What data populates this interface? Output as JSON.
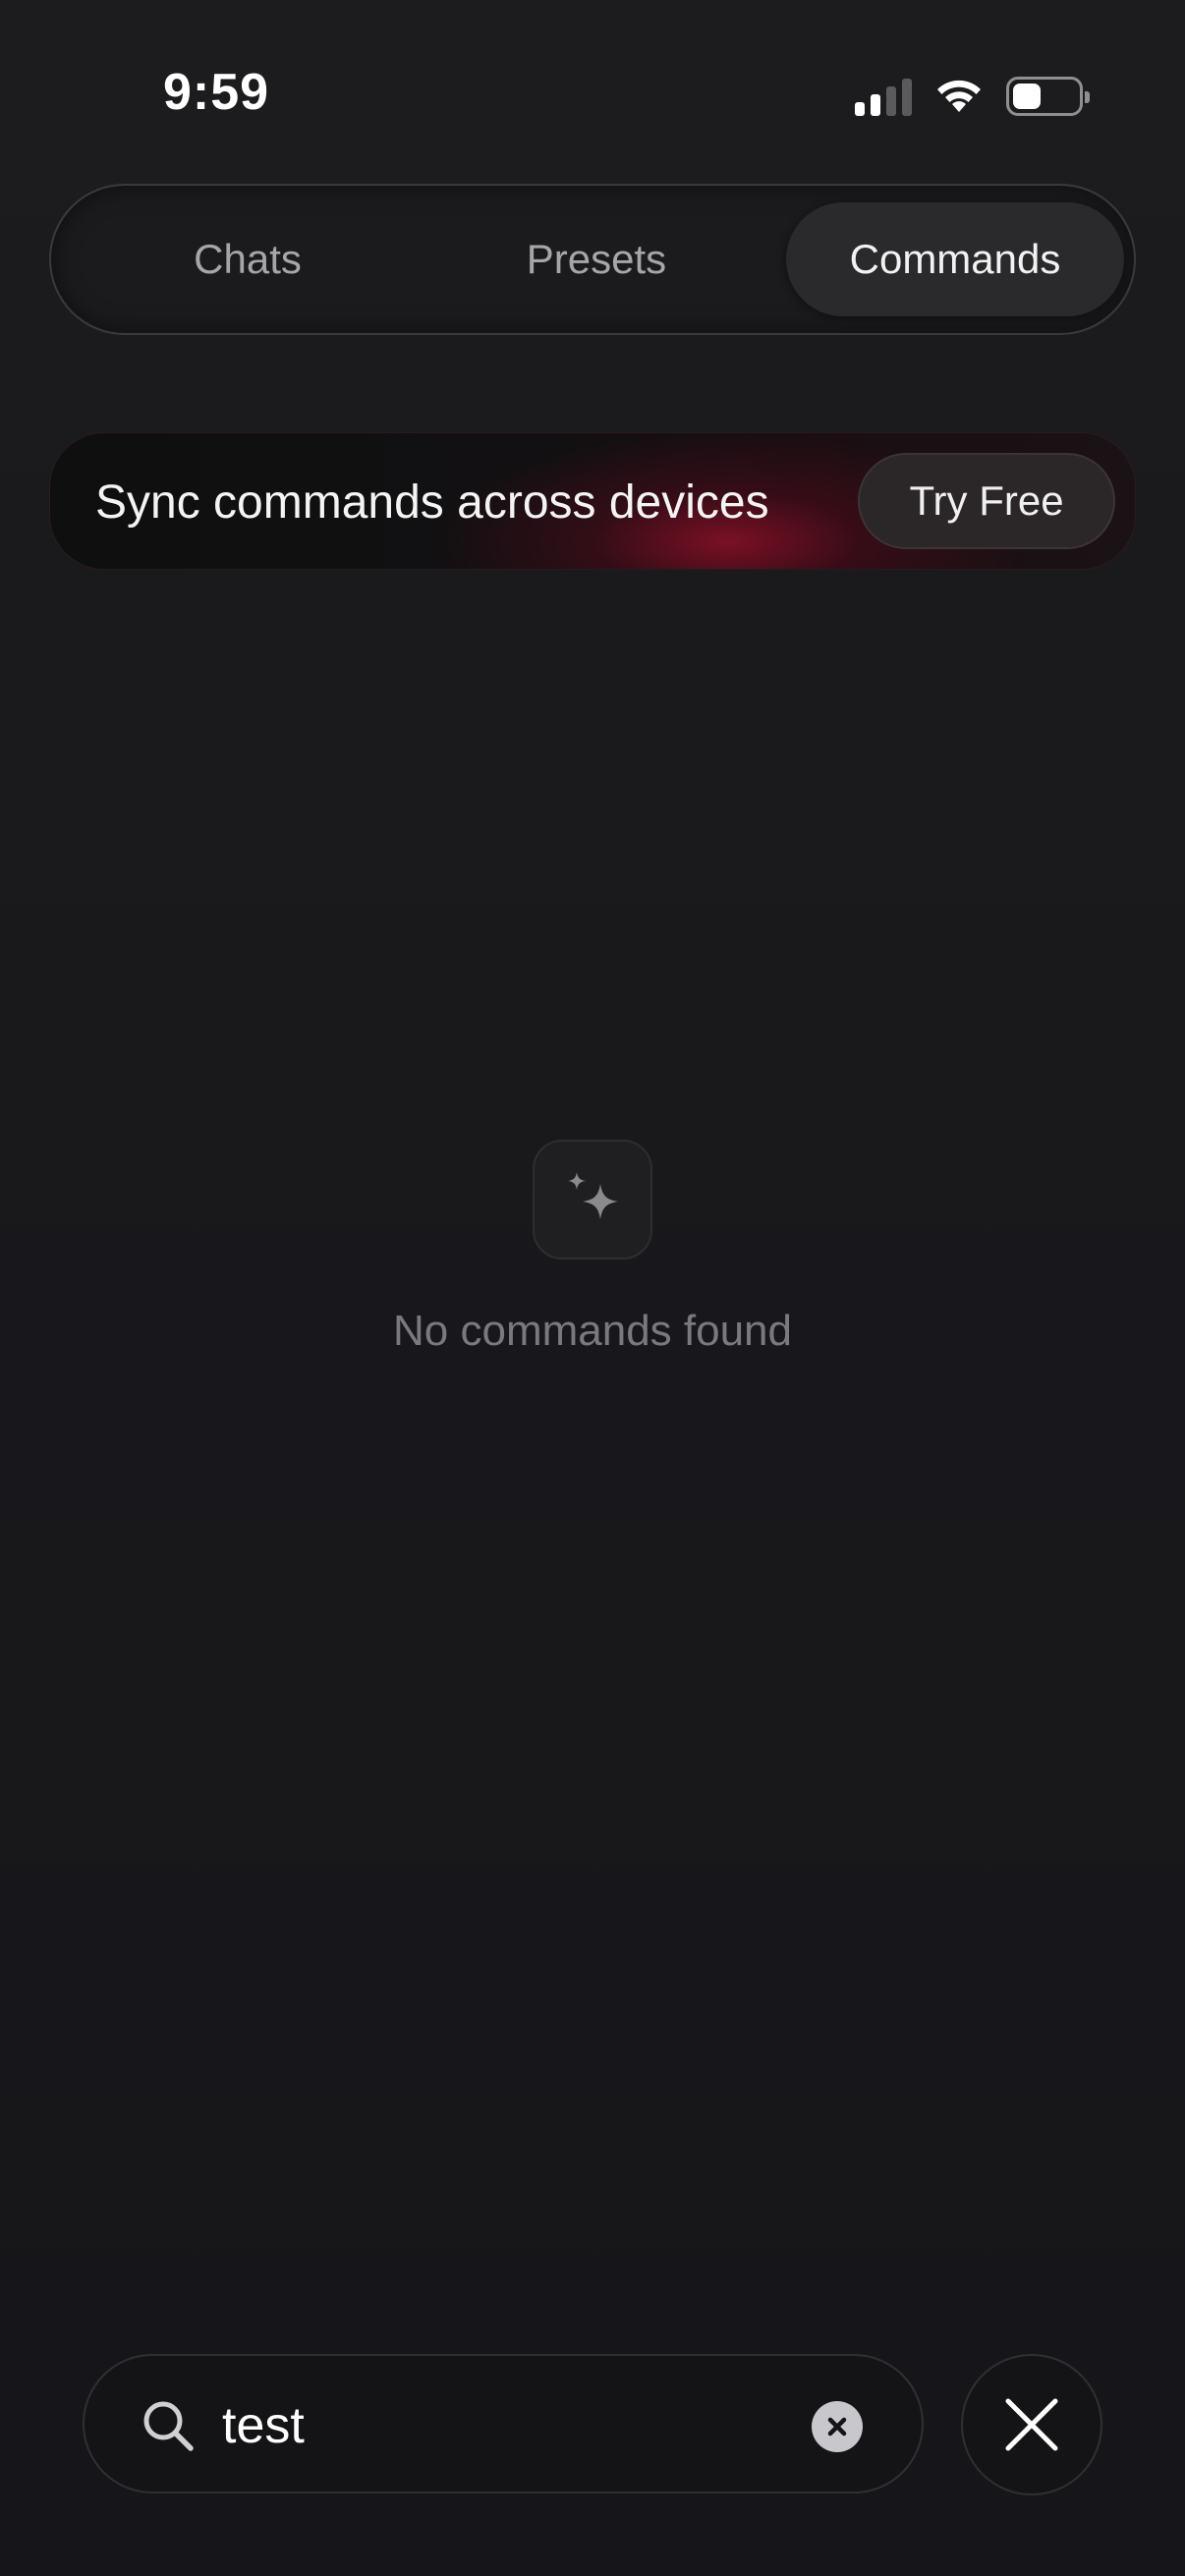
{
  "status_bar": {
    "time": "9:59",
    "icons": [
      "cellular-signal-icon",
      "wifi-icon",
      "battery-icon"
    ]
  },
  "tabs": [
    {
      "label": "Chats",
      "selected": false
    },
    {
      "label": "Presets",
      "selected": false
    },
    {
      "label": "Commands",
      "selected": true
    }
  ],
  "promo": {
    "text": "Sync commands across devices",
    "button_label": "Try Free",
    "accent_color": "#8c1028"
  },
  "empty_state": {
    "icon": "sparkles-icon",
    "message": "No commands found"
  },
  "search": {
    "value": "test",
    "icon": "search-icon",
    "clear_icon": "clear-x-circle-icon"
  },
  "close_button": {
    "icon": "close-icon"
  }
}
